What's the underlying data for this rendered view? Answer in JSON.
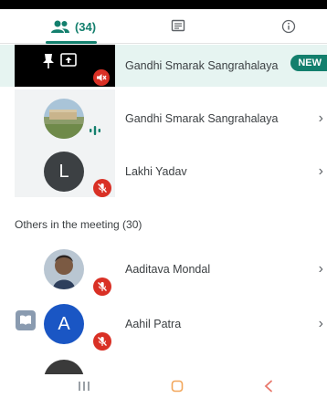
{
  "tabs": {
    "people_count": "(34)"
  },
  "presenting": {
    "name": "Gandhi Smarak Sangrahalaya",
    "badge": "NEW"
  },
  "in_meeting": [
    {
      "name": "Gandhi Smarak Sangrahalaya",
      "avatar": "photo"
    },
    {
      "name": "Lakhi Yadav",
      "avatar_letter": "L"
    }
  ],
  "others": {
    "label": "Others in the meeting (30)",
    "items": [
      {
        "name": "Aaditava Mondal",
        "avatar": "photo"
      },
      {
        "name": "Aahil Patra",
        "avatar_letter": "A"
      }
    ]
  },
  "colors": {
    "accent": "#137f6d",
    "mute": "#d93025"
  },
  "icons": [
    "people-icon",
    "chat-icon",
    "info-icon",
    "pin-icon",
    "present-icon",
    "volume-off-icon",
    "mic-off-icon",
    "chevron-right-icon"
  ]
}
